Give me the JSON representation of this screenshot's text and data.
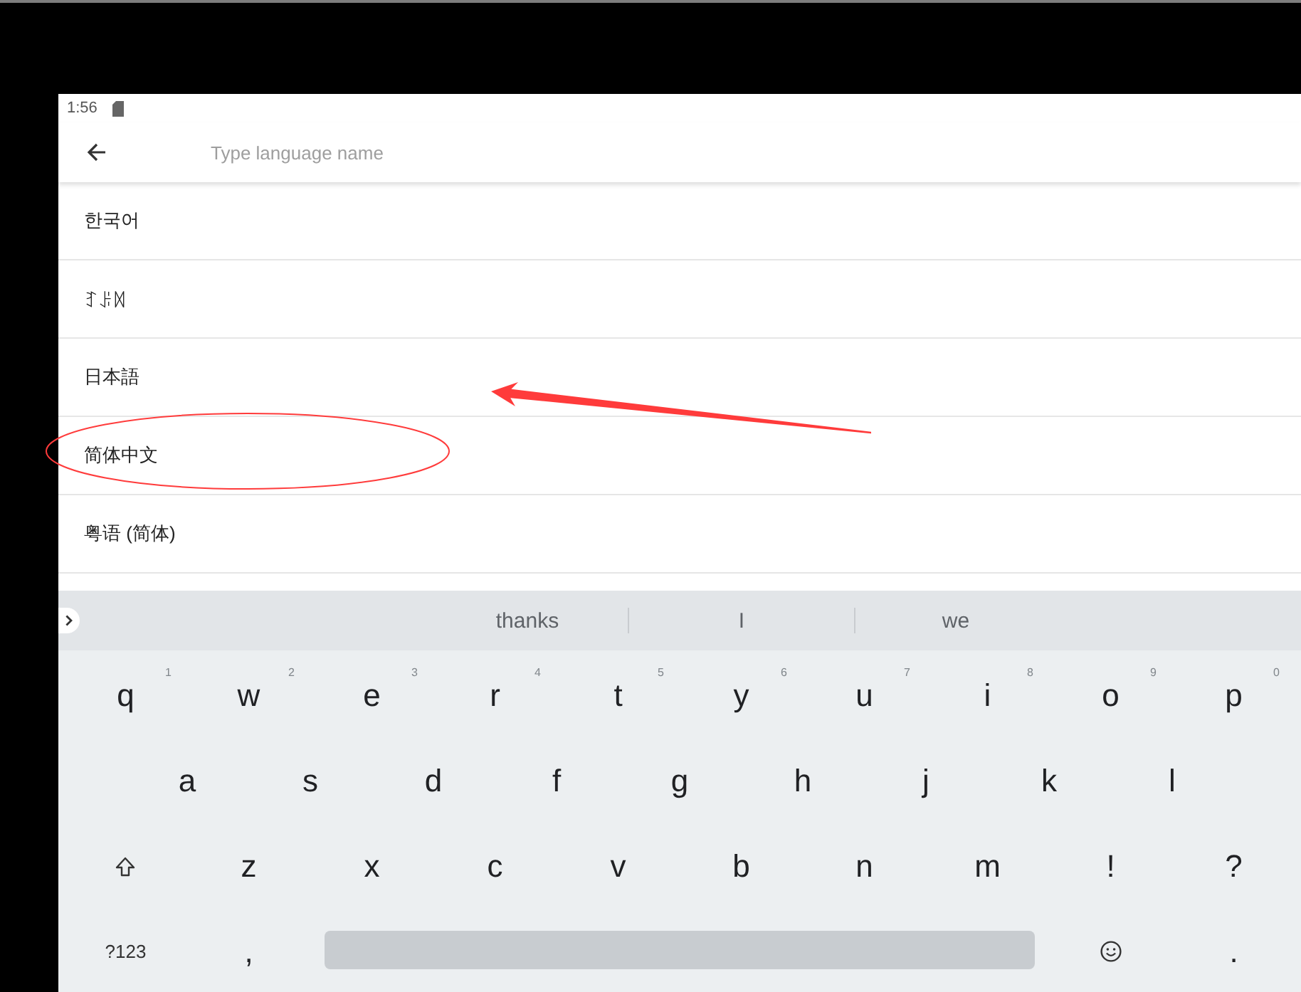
{
  "status_bar": {
    "time": "1:56"
  },
  "toolbar": {
    "search": {
      "placeholder": "Type language name"
    }
  },
  "languages": [
    {
      "name": "한국어",
      "circled": false
    },
    {
      "name": "ꆈꌠꉙ",
      "circled": false
    },
    {
      "name": "日本語",
      "circled": false
    },
    {
      "name": "简体中文",
      "circled": true
    },
    {
      "name": "粤语 (简体)",
      "circled": false
    }
  ],
  "keyboard": {
    "suggestions": [
      "thanks",
      "I",
      "we"
    ],
    "rows": [
      [
        {
          "kind": "char",
          "label": "q",
          "hint": "1"
        },
        {
          "kind": "char",
          "label": "w",
          "hint": "2"
        },
        {
          "kind": "char",
          "label": "e",
          "hint": "3"
        },
        {
          "kind": "char",
          "label": "r",
          "hint": "4"
        },
        {
          "kind": "char",
          "label": "t",
          "hint": "5"
        },
        {
          "kind": "char",
          "label": "y",
          "hint": "6"
        },
        {
          "kind": "char",
          "label": "u",
          "hint": "7"
        },
        {
          "kind": "char",
          "label": "i",
          "hint": "8"
        },
        {
          "kind": "char",
          "label": "o",
          "hint": "9"
        },
        {
          "kind": "char",
          "label": "p",
          "hint": "0"
        }
      ],
      [
        {
          "kind": "char",
          "label": "a"
        },
        {
          "kind": "char",
          "label": "s"
        },
        {
          "kind": "char",
          "label": "d"
        },
        {
          "kind": "char",
          "label": "f"
        },
        {
          "kind": "char",
          "label": "g"
        },
        {
          "kind": "char",
          "label": "h"
        },
        {
          "kind": "char",
          "label": "j"
        },
        {
          "kind": "char",
          "label": "k"
        },
        {
          "kind": "char",
          "label": "l"
        }
      ],
      [
        {
          "kind": "shift"
        },
        {
          "kind": "char",
          "label": "z"
        },
        {
          "kind": "char",
          "label": "x"
        },
        {
          "kind": "char",
          "label": "c"
        },
        {
          "kind": "char",
          "label": "v"
        },
        {
          "kind": "char",
          "label": "b"
        },
        {
          "kind": "char",
          "label": "n"
        },
        {
          "kind": "char",
          "label": "m"
        },
        {
          "kind": "char",
          "label": "!"
        },
        {
          "kind": "char",
          "label": "?"
        }
      ],
      [
        {
          "kind": "symbols",
          "label": "?123"
        },
        {
          "kind": "char",
          "label": ","
        },
        {
          "kind": "space"
        },
        "",
        "",
        "",
        "",
        "",
        {
          "kind": "emoji"
        },
        {
          "kind": "char",
          "label": "."
        }
      ]
    ]
  },
  "annotations": [
    {
      "kind": "arrow"
    }
  ]
}
